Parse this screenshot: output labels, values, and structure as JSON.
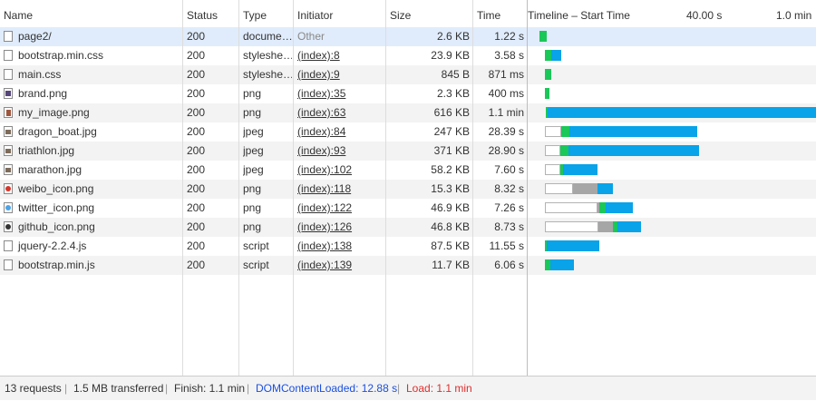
{
  "columns": {
    "name": "Name",
    "status": "Status",
    "type": "Type",
    "initiator": "Initiator",
    "size": "Size",
    "time": "Time",
    "timeline": "Timeline – Start Time",
    "tick1": "40.00 s",
    "tick2": "1.0 min"
  },
  "requests": [
    {
      "name": "page2/",
      "icon": "document-icon",
      "status": "200",
      "type": "docume…",
      "initiator": "Other",
      "initiator_link": false,
      "size": "2.6 KB",
      "time": "1.22 s"
    },
    {
      "name": "bootstrap.min.css",
      "icon": "document-icon",
      "status": "200",
      "type": "styleshe…",
      "initiator": "(index):8",
      "initiator_link": true,
      "size": "23.9 KB",
      "time": "3.58 s"
    },
    {
      "name": "main.css",
      "icon": "document-icon",
      "status": "200",
      "type": "styleshe…",
      "initiator": "(index):9",
      "initiator_link": true,
      "size": "845 B",
      "time": "871 ms"
    },
    {
      "name": "brand.png",
      "icon": "image-icon",
      "status": "200",
      "type": "png",
      "initiator": "(index):35",
      "initiator_link": true,
      "size": "2.3 KB",
      "time": "400 ms"
    },
    {
      "name": "my_image.png",
      "icon": "image-icon",
      "status": "200",
      "type": "png",
      "initiator": "(index):63",
      "initiator_link": true,
      "size": "616 KB",
      "time": "1.1 min"
    },
    {
      "name": "dragon_boat.jpg",
      "icon": "image-icon",
      "status": "200",
      "type": "jpeg",
      "initiator": "(index):84",
      "initiator_link": true,
      "size": "247 KB",
      "time": "28.39 s"
    },
    {
      "name": "triathlon.jpg",
      "icon": "image-icon",
      "status": "200",
      "type": "jpeg",
      "initiator": "(index):93",
      "initiator_link": true,
      "size": "371 KB",
      "time": "28.90 s"
    },
    {
      "name": "marathon.jpg",
      "icon": "image-icon",
      "status": "200",
      "type": "jpeg",
      "initiator": "(index):102",
      "initiator_link": true,
      "size": "58.2 KB",
      "time": "7.60 s"
    },
    {
      "name": "weibo_icon.png",
      "icon": "image-icon",
      "status": "200",
      "type": "png",
      "initiator": "(index):118",
      "initiator_link": true,
      "size": "15.3 KB",
      "time": "8.32 s"
    },
    {
      "name": "twitter_icon.png",
      "icon": "image-icon",
      "status": "200",
      "type": "png",
      "initiator": "(index):122",
      "initiator_link": true,
      "size": "46.9 KB",
      "time": "7.26 s"
    },
    {
      "name": "github_icon.png",
      "icon": "image-icon",
      "status": "200",
      "type": "png",
      "initiator": "(index):126",
      "initiator_link": true,
      "size": "46.8 KB",
      "time": "8.73 s"
    },
    {
      "name": "jquery-2.2.4.js",
      "icon": "document-icon",
      "status": "200",
      "type": "script",
      "initiator": "(index):138",
      "initiator_link": true,
      "size": "87.5 KB",
      "time": "11.55 s"
    },
    {
      "name": "bootstrap.min.js",
      "icon": "document-icon",
      "status": "200",
      "type": "script",
      "initiator": "(index):139",
      "initiator_link": true,
      "size": "11.7 KB",
      "time": "6.06 s"
    }
  ],
  "summary": {
    "requests": "13 requests",
    "transferred": "1.5 MB transferred",
    "finish": "Finish: 1.1 min",
    "dom_content_loaded": "DOMContentLoaded: 12.88 s",
    "load": "Load: 1.1 min"
  },
  "colors": {
    "waiting": "#ffffff",
    "queueing": "#a6a6a6",
    "ttfb": "#1ac759",
    "download": "#08a3e8",
    "dom_content_loaded": "#1a4fe0",
    "load": "#e02c2c"
  }
}
